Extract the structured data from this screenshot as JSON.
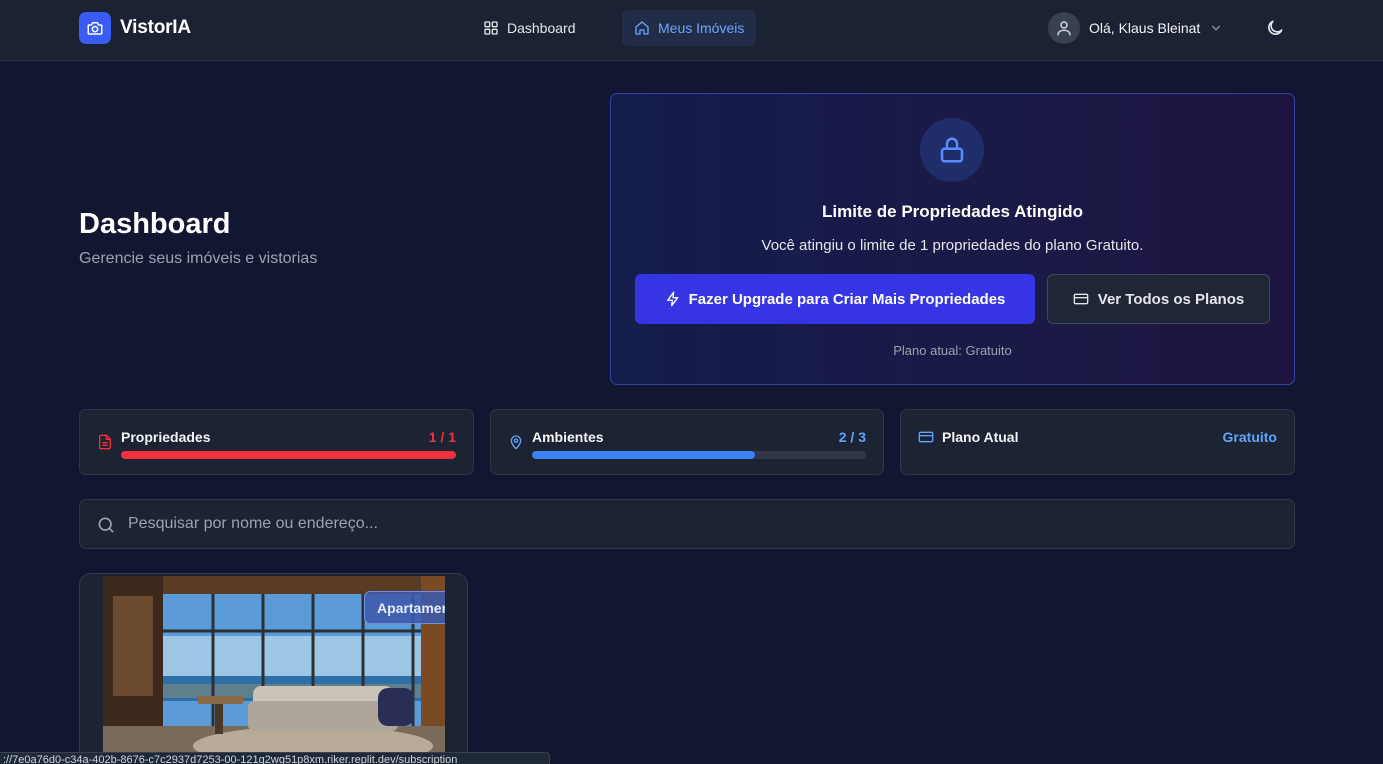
{
  "app": {
    "name": "VistorIA",
    "logo_icon": "camera-icon",
    "accent_color": "#3b5bf5"
  },
  "nav": {
    "items": [
      {
        "label": "Dashboard",
        "icon": "grid-icon",
        "active": false
      },
      {
        "label": "Meus Imóveis",
        "icon": "home-icon",
        "active": true
      }
    ]
  },
  "user": {
    "greeting": "Olá, Klaus Bleinat",
    "avatar_icon": "user-icon"
  },
  "theme_toggle_icon": "moon-icon",
  "header": {
    "title": "Dashboard",
    "subtitle": "Gerencie seus imóveis e vistorias"
  },
  "limit_notice": {
    "icon": "lock-icon",
    "title": "Limite de Propriedades Atingido",
    "message": "Você atingiu o limite de 1 propriedades do plano Gratuito.",
    "upgrade_button": "Fazer Upgrade para Criar Mais Propriedades",
    "plans_button": "Ver Todos os Planos",
    "current_plan_note": "Plano atual: Gratuito"
  },
  "stats": [
    {
      "label": "Propriedades",
      "value": "1 / 1",
      "icon": "document-icon",
      "progress": 1.0,
      "color": "#f4303d"
    },
    {
      "label": "Ambientes",
      "value": "2 / 3",
      "icon": "map-pin-icon",
      "progress": 0.667,
      "color": "#3b82f6"
    },
    {
      "label": "Plano Atual",
      "value": "Gratuito",
      "icon": "credit-card-icon",
      "color": "#60a5fa"
    }
  ],
  "search": {
    "placeholder": "Pesquisar por nome ou endereço...",
    "value": ""
  },
  "properties": [
    {
      "type_badge": "Apartamento",
      "image": "living-room-photo"
    }
  ],
  "status_bar": {
    "url": "://7e0a76d0-c34a-402b-8676-c7c2937d7253-00-121g2wg51p8xm.riker.replit.dev/subscription"
  }
}
